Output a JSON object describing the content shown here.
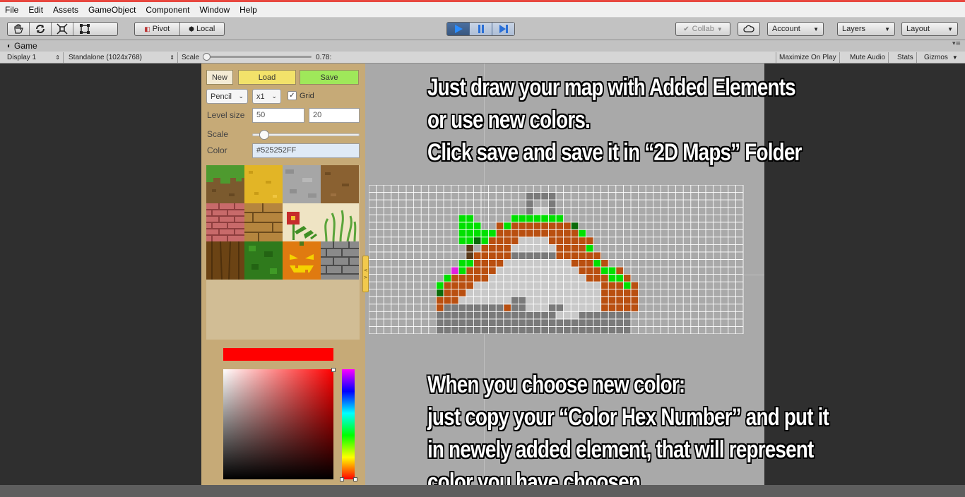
{
  "menubar": {
    "items": [
      "File",
      "Edit",
      "Assets",
      "GameObject",
      "Component",
      "Window",
      "Help"
    ]
  },
  "toolbar": {
    "tools": [
      "hand-tool",
      "move-tool",
      "rotate-tool",
      "scale-tool",
      "rect-tool"
    ],
    "pivot_label": "Pivot",
    "local_label": "Local",
    "collab_label": "Collab",
    "account_label": "Account",
    "layers_label": "Layers",
    "layout_label": "Layout"
  },
  "game_tab": {
    "title": "Game",
    "display": "Display 1",
    "resolution": "Standalone (1024x768)",
    "scale_label": "Scale",
    "scale_value": "0.78:",
    "maximize": "Maximize On Play",
    "mute": "Mute Audio",
    "stats": "Stats",
    "gizmos": "Gizmos"
  },
  "editor_panel": {
    "new_label": "New",
    "load_label": "Load",
    "save_label": "Save",
    "tool_select": "Pencil",
    "zoom_select": "x1",
    "grid_label": "Grid",
    "grid_checked": true,
    "level_size_label": "Level size",
    "level_width": "50",
    "level_height": "20",
    "scale_label": "Scale",
    "scale_level": 0.1,
    "color_label": "Color",
    "color_value": "#525252FF",
    "selected_color": "#ff0000"
  },
  "palette": {
    "tiles": [
      "grass",
      "sand",
      "stone",
      "dirt",
      "red-bricks",
      "wood-planks",
      "flower",
      "tall-grass",
      "bark",
      "leaves",
      "pumpkin",
      "stone-bricks"
    ]
  },
  "captions": {
    "top": [
      "Just draw your map with Added Elements",
      "or use new colors.",
      "Click save and save it in “2D Maps” Folder"
    ],
    "bottom": [
      "When you choose new color:",
      "just copy your “Color Hex Number” and put it",
      "in newely added element, that will represent",
      "color you have choosen"
    ]
  }
}
